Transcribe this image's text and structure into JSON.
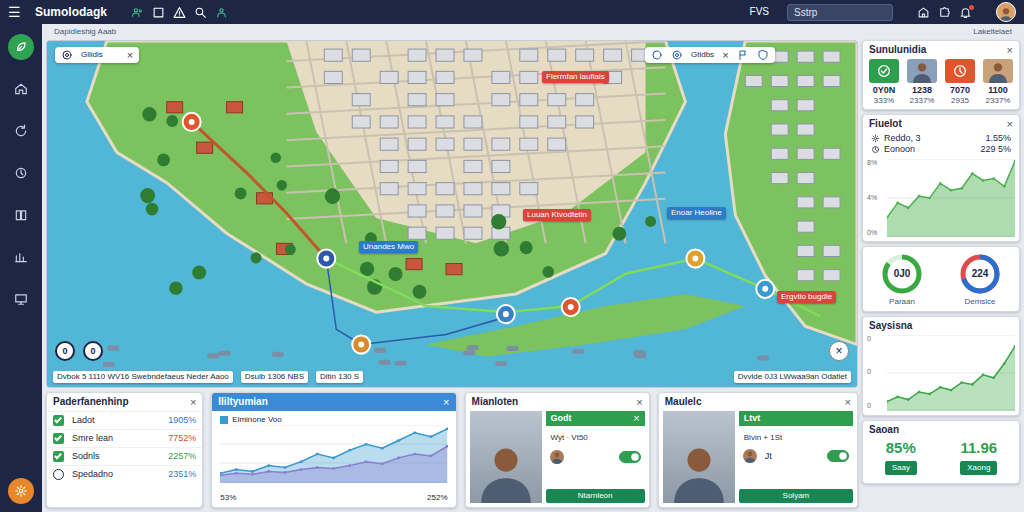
{
  "app": {
    "menu_icon": "☰",
    "title": "Sumolodagk",
    "badge": "FVS",
    "search": {
      "placeholder": "Sstrp"
    }
  },
  "subheader": {
    "left": "Dapidleshig Aaab",
    "right": "Lakeltelaet"
  },
  "sidebar": {
    "items": [
      {
        "selected": true
      },
      {
        "selected": false
      },
      {
        "selected": false
      },
      {
        "selected": false
      },
      {
        "selected": false
      },
      {
        "selected": false
      },
      {
        "selected": false
      }
    ]
  },
  "map": {
    "search_chip": {
      "text": "Gliidis",
      "close": "×"
    },
    "toolbar": {
      "label": "Gtidbs",
      "close": "×"
    },
    "labels": [
      {
        "text": "Flermfan laufiais",
        "color": "#d9453a"
      },
      {
        "text": "Luuan Ktvodtetin",
        "color": "#d9453a"
      },
      {
        "text": "Unandes Mwo",
        "color": "#2a7bc8"
      },
      {
        "text": "Enoar Heoline",
        "color": "#2a7bc8"
      },
      {
        "text": "Ergvtio bugdle",
        "color": "#d9453a"
      }
    ],
    "pins": [
      {
        "color": "#e0552b"
      },
      {
        "color": "#3058a8"
      },
      {
        "color": "#d98a2b"
      },
      {
        "color": "#3a7fc8"
      },
      {
        "color": "#e0a030"
      },
      {
        "color": "#e0552b"
      },
      {
        "color": "#3a9ad0"
      }
    ],
    "toggles": [
      "0",
      "0"
    ],
    "zoom_close": "×",
    "status_left": [
      "Dvbok 5 1110 WV16 Swebndefaeus Neder Aaoo",
      "Dsulb 1306 NBS",
      "Ditin 130 S"
    ],
    "status_right": "Dvvlde 0J3 LWwaa9an Odatlet"
  },
  "summary": {
    "title": "Sunulunidia",
    "close": "×",
    "tiles": [
      {
        "value": "0Y0N",
        "sub": "333%",
        "color": "#2e9e4f"
      },
      {
        "value": "1238",
        "sub": "2337%",
        "color": "#8aa0b8"
      },
      {
        "value": "7070",
        "sub": "2935",
        "color": "#e0552b"
      },
      {
        "value": "1100",
        "sub": "2337%",
        "color": "#c9a27a"
      }
    ]
  },
  "fuel": {
    "title": "Fiuelot",
    "close": "×",
    "rows": [
      {
        "label": "Reddo, 3",
        "value": "1.55%"
      },
      {
        "label": "Eonoon",
        "value": "229 5%"
      }
    ],
    "ticks": [
      "8%",
      "4%",
      "0%"
    ],
    "series": [
      [
        2,
        3.5,
        3,
        4.2,
        4,
        5.5,
        4.8,
        5,
        6.5,
        5.8,
        6,
        5.2,
        7.8
      ]
    ]
  },
  "gauges": [
    {
      "value": "0J0",
      "label": "Paraan",
      "level": 0.85,
      "color": "#3aa845",
      "track": "#d8efd8"
    },
    {
      "value": "224",
      "label": "Demsice",
      "level": 0.7,
      "color": "#2a6fd0",
      "track": "#e04a4a"
    }
  ],
  "stats": {
    "title": "Saysisna",
    "ticks": [
      "0",
      "0",
      "0"
    ],
    "series": [
      [
        1,
        1.5,
        1.2,
        2,
        1.8,
        2.5,
        2.2,
        3,
        2.8,
        3.8,
        3.5,
        5,
        6.8
      ]
    ]
  },
  "score": {
    "title": "Saoan",
    "values": [
      {
        "value": "85%",
        "button": "Saay"
      },
      {
        "value": "11.96",
        "button": "Xaong"
      }
    ]
  },
  "list_card": {
    "title": "Paderfanenhinp",
    "close": "×",
    "rows": [
      {
        "label": "Ladot",
        "value": "1905%",
        "checked": true,
        "color": "#2a7bc8"
      },
      {
        "label": "Smre lean",
        "value": "7752%",
        "checked": true,
        "color": "#d9453a"
      },
      {
        "label": "Sodnls",
        "value": "2257%",
        "checked": true,
        "color": "#2e9e4f"
      },
      {
        "label": "Spedadno",
        "value": "2351%",
        "checked": false,
        "color": "#2a7bc8"
      }
    ]
  },
  "chart_card": {
    "title": "Ililtyumian",
    "close": "×",
    "legend": "Elminone Voo",
    "x_labels": [
      "53%",
      "252%"
    ],
    "series": [
      {
        "color": "#3a9ad0",
        "values": [
          10,
          14,
          12,
          18,
          16,
          22,
          30,
          26,
          34,
          40,
          36,
          44,
          52,
          48,
          56
        ]
      },
      {
        "color": "#8a7fd0",
        "values": [
          8,
          10,
          9,
          12,
          11,
          14,
          16,
          15,
          18,
          22,
          20,
          26,
          30,
          28,
          38
        ]
      }
    ]
  },
  "people": [
    {
      "title": "Mianloten",
      "close": "×",
      "panel_title": "Godt",
      "panel_close": "×",
      "detail": "Wyt · Vt50",
      "on": true,
      "button": "Ntarnleon"
    },
    {
      "title": "Maulelc",
      "close": "×",
      "panel_title": "Ltvt",
      "detail": "Blvin + 1St",
      "note": "Jt",
      "on": true,
      "button": "Solyam"
    }
  ]
}
